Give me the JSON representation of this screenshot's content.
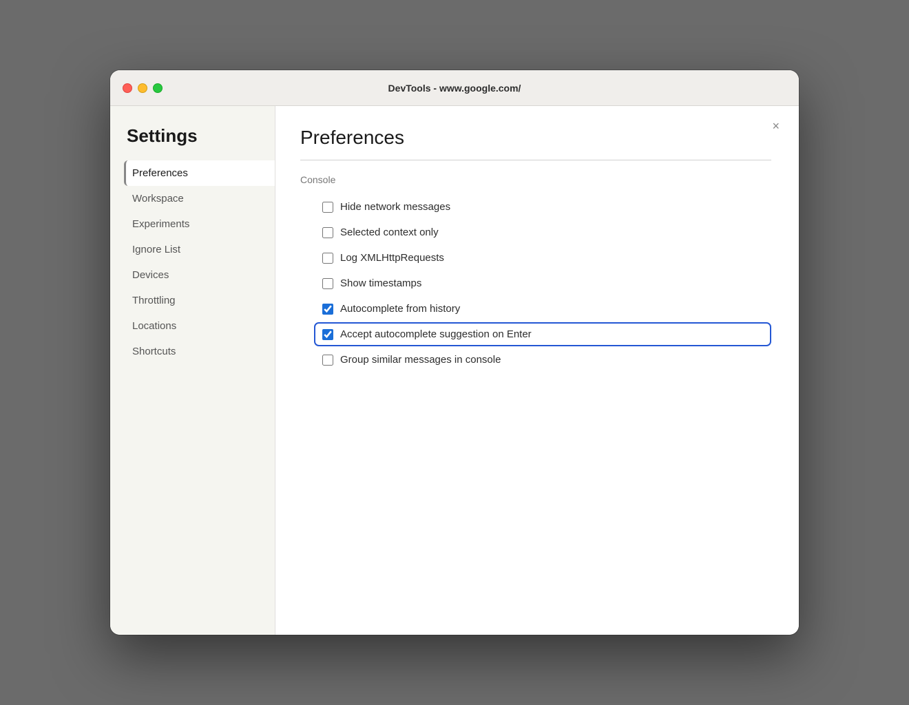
{
  "window": {
    "title": "DevTools - www.google.com/"
  },
  "sidebar": {
    "heading": "Settings",
    "items": [
      {
        "id": "preferences",
        "label": "Preferences",
        "active": true
      },
      {
        "id": "workspace",
        "label": "Workspace",
        "active": false
      },
      {
        "id": "experiments",
        "label": "Experiments",
        "active": false
      },
      {
        "id": "ignore-list",
        "label": "Ignore List",
        "active": false
      },
      {
        "id": "devices",
        "label": "Devices",
        "active": false
      },
      {
        "id": "throttling",
        "label": "Throttling",
        "active": false
      },
      {
        "id": "locations",
        "label": "Locations",
        "active": false
      },
      {
        "id": "shortcuts",
        "label": "Shortcuts",
        "active": false
      }
    ]
  },
  "main": {
    "title": "Preferences",
    "close_label": "×",
    "subsection": "Console",
    "checkboxes": [
      {
        "id": "hide-network",
        "label": "Hide network messages",
        "checked": false,
        "highlighted": false
      },
      {
        "id": "selected-context",
        "label": "Selected context only",
        "checked": false,
        "highlighted": false
      },
      {
        "id": "log-xml",
        "label": "Log XMLHttpRequests",
        "checked": false,
        "highlighted": false
      },
      {
        "id": "show-timestamps",
        "label": "Show timestamps",
        "checked": false,
        "highlighted": false
      },
      {
        "id": "autocomplete-history",
        "label": "Autocomplete from history",
        "checked": true,
        "highlighted": false
      },
      {
        "id": "autocomplete-enter",
        "label": "Accept autocomplete suggestion on Enter",
        "checked": true,
        "highlighted": true
      },
      {
        "id": "group-similar",
        "label": "Group similar messages in console",
        "checked": false,
        "highlighted": false
      }
    ]
  }
}
